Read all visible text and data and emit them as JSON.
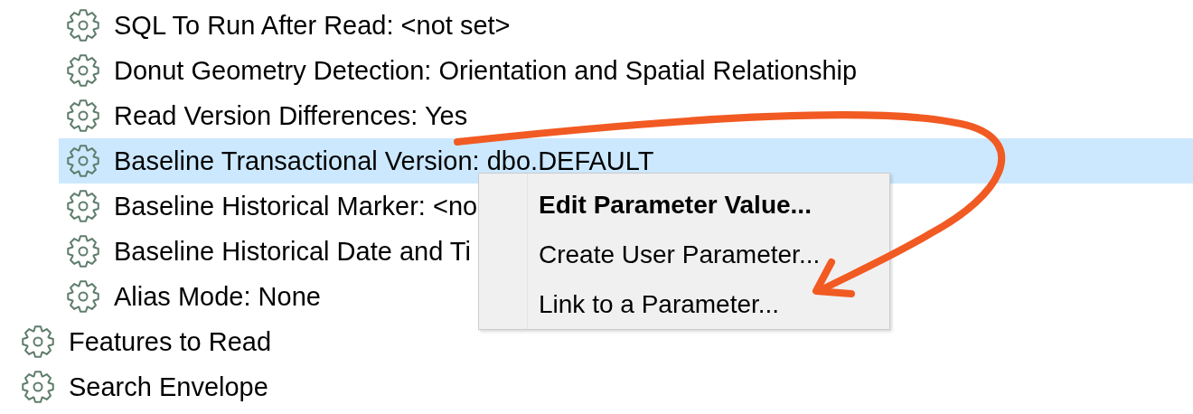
{
  "tree": [
    {
      "children": [
        {
          "label": "SQL To Run After Read: <not set>",
          "selected": false
        },
        {
          "label": "Donut Geometry Detection: Orientation and Spatial Relationship",
          "selected": false
        },
        {
          "label": "Read Version Differences: Yes",
          "selected": false
        },
        {
          "label": "Baseline Transactional Version: dbo.DEFAULT",
          "selected": true
        },
        {
          "label": "Baseline Historical Marker: <no",
          "selected": false
        },
        {
          "label": "Baseline Historical Date and Ti",
          "selected": false
        },
        {
          "label": "Alias Mode: None",
          "selected": false
        }
      ]
    },
    {
      "label": "Features to Read",
      "selected": false
    },
    {
      "label": "Search Envelope",
      "selected": false
    }
  ],
  "context_menu": {
    "items": [
      {
        "label": "Edit Parameter Value...",
        "default": true
      },
      {
        "label": "Create User Parameter...",
        "default": false
      },
      {
        "label": "Link to a Parameter...",
        "default": false
      }
    ]
  }
}
